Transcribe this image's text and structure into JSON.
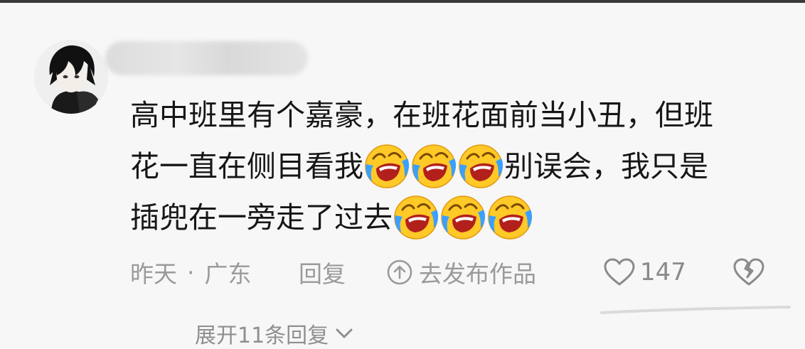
{
  "comment": {
    "username": "",
    "lines": [
      {
        "text_before": "高中班里有个嘉豪，在班花面前当小丑，但班",
        "emoji_count": 0,
        "text_after": ""
      },
      {
        "text_before": "花一直在侧目看我",
        "emoji_count": 3,
        "text_after": "别误会，我只是"
      },
      {
        "text_before": "插兜在一旁走了过去",
        "emoji_count": 3,
        "text_after": ""
      }
    ],
    "emoji_name": "laughing-crying-emoji"
  },
  "meta": {
    "time": "昨天",
    "separator": "·",
    "location": "广东"
  },
  "actions": {
    "reply_label": "回复",
    "share_label": "去发布作品",
    "like_count": "147"
  },
  "expand": {
    "label": "展开11条回复"
  },
  "colors": {
    "background": "#f7f7f7",
    "text": "#161616",
    "meta_text": "#9a9a9a"
  }
}
